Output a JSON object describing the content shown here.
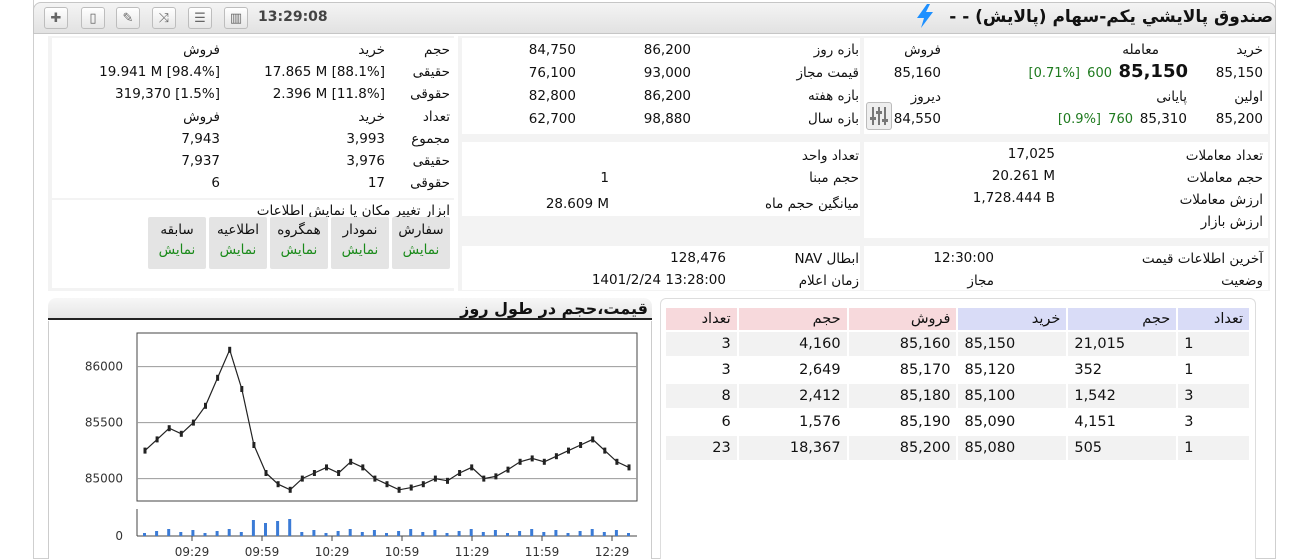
{
  "header": {
    "time": "13:29:08",
    "title": "صندوق پالايشي يكم-سهام (پالايش) - -",
    "toolbar_icons": [
      "plus-icon",
      "notepad-icon",
      "edit-icon",
      "compare-icon",
      "list-icon",
      "bar-chart-icon"
    ]
  },
  "price_panel": {
    "labels": {
      "buy": "خرید",
      "trade": "معامله",
      "sell": "فروش",
      "first": "اولین",
      "final": "پایانی",
      "yesterday": "دیروز"
    },
    "buy": "85,150",
    "trade_price": "85,150",
    "trade_change": "600",
    "trade_pct": "[0.71%]",
    "sell": "85,160",
    "first": "85,200",
    "final_price": "85,310",
    "final_change": "760",
    "final_pct": "[0.9%]",
    "yesterday": "84,550"
  },
  "range_panel": {
    "rows": [
      {
        "label": "بازه روز",
        "a": "86,200",
        "b": "84,750"
      },
      {
        "label": "قیمت مجاز",
        "a": "93,000",
        "b": "76,100"
      },
      {
        "label": "بازه هفته",
        "a": "86,200",
        "b": "82,800"
      },
      {
        "label": "بازه سال",
        "a": "98,880",
        "b": "62,700"
      }
    ]
  },
  "trade_stats": {
    "count_label": "تعداد معاملات",
    "count": "17,025",
    "volume_label": "حجم معاملات",
    "volume": "20.261 M",
    "value_label": "ارزش معاملات",
    "value": "1,728.444 B",
    "market_label": "ارزش بازار",
    "market": ""
  },
  "unit_stats": {
    "unit_label": "تعداد واحد",
    "unit": "",
    "base_label": "حجم مبنا",
    "base": "1",
    "month_label": "میانگین حجم ماه",
    "month": "28.609 M"
  },
  "price_info": {
    "last_label": "آخرین اطلاعات قیمت",
    "last": "12:30:00",
    "status_label": "وضعیت",
    "status": "مجاز"
  },
  "nav": {
    "nav_label": "NAV ابطال",
    "nav": "128,476",
    "time_label": "زمان اعلام",
    "time": "1401/2/24 13:28:00"
  },
  "client_panel": {
    "head": {
      "volume": "حجم",
      "buy": "خرید",
      "sell": "فروش"
    },
    "rows": [
      {
        "label": "حقیقی",
        "buy": "17.865 M [88.1%]",
        "sell": "19.941 M [98.4%]"
      },
      {
        "label": "حقوقی",
        "buy": "2.396 M [11.8%]",
        "sell": "319,370 [1.5%]"
      }
    ],
    "head2": {
      "count": "تعداد",
      "buy": "خرید",
      "sell": "فروش"
    },
    "rows2": [
      {
        "label": "مجموع",
        "buy": "3,993",
        "sell": "7,943"
      },
      {
        "label": "حقیقی",
        "buy": "3,976",
        "sell": "7,937"
      },
      {
        "label": "حقوقی",
        "buy": "17",
        "sell": "6"
      }
    ]
  },
  "tools": {
    "title": "ابزار تغییر مکان یا نمایش اطلاعات",
    "show": "نمایش",
    "buttons": [
      "سفارش",
      "نمودار",
      "همگروه",
      "اطلاعیه",
      "سابقه"
    ]
  },
  "chart_title": "قیمت،حجم در طول روز",
  "chart_data": {
    "type": "line",
    "title": "قیمت،حجم در طول روز",
    "x_ticks": [
      "09:29",
      "09:59",
      "10:29",
      "10:59",
      "11:29",
      "11:59",
      "12:29"
    ],
    "y_ticks": [
      85000,
      85500,
      86000
    ],
    "ylim": [
      84800,
      86300
    ],
    "volume_ticks": [
      0
    ],
    "series": [
      {
        "values": [
          85250,
          85350,
          85450,
          85400,
          85500,
          85650,
          85900,
          86150,
          85800,
          85300,
          85050,
          84950,
          84900,
          85000,
          85050,
          85100,
          85050,
          85150,
          85100,
          85000,
          84950,
          84900,
          84920,
          84950,
          85000,
          84980,
          85050,
          85100,
          85000,
          85020,
          85080,
          85150,
          85180,
          85150,
          85200,
          85250,
          85300,
          85350,
          85250,
          85150,
          85100
        ]
      }
    ]
  },
  "orderbook": {
    "headers": [
      "تعداد",
      "حجم",
      "خرید",
      "فروش",
      "حجم",
      "تعداد"
    ],
    "rows": [
      [
        "1",
        "21,015",
        "85,150",
        "85,160",
        "4,160",
        "3"
      ],
      [
        "1",
        "352",
        "85,120",
        "85,170",
        "2,649",
        "3"
      ],
      [
        "3",
        "1,542",
        "85,100",
        "85,180",
        "2,412",
        "8"
      ],
      [
        "3",
        "4,151",
        "85,090",
        "85,190",
        "1,576",
        "6"
      ],
      [
        "1",
        "505",
        "85,080",
        "85,200",
        "18,367",
        "23"
      ]
    ]
  }
}
